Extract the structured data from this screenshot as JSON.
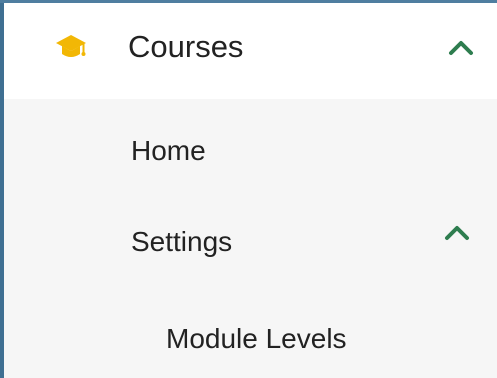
{
  "menu": {
    "header": {
      "icon": "graduation-cap-icon",
      "label": "Courses",
      "expanded": true,
      "chevron": "chevron-up-icon"
    },
    "items": [
      {
        "label": "Home"
      },
      {
        "label": "Settings",
        "expanded": true,
        "chevron": "chevron-up-icon",
        "children": [
          {
            "label": "Module Levels"
          }
        ]
      }
    ]
  },
  "colors": {
    "icon_accent": "#f2b705",
    "chevron": "#2e7d4f",
    "border": "#3f6f92",
    "submenu_background": "#f6f6f6",
    "header_background": "#ffffff"
  }
}
